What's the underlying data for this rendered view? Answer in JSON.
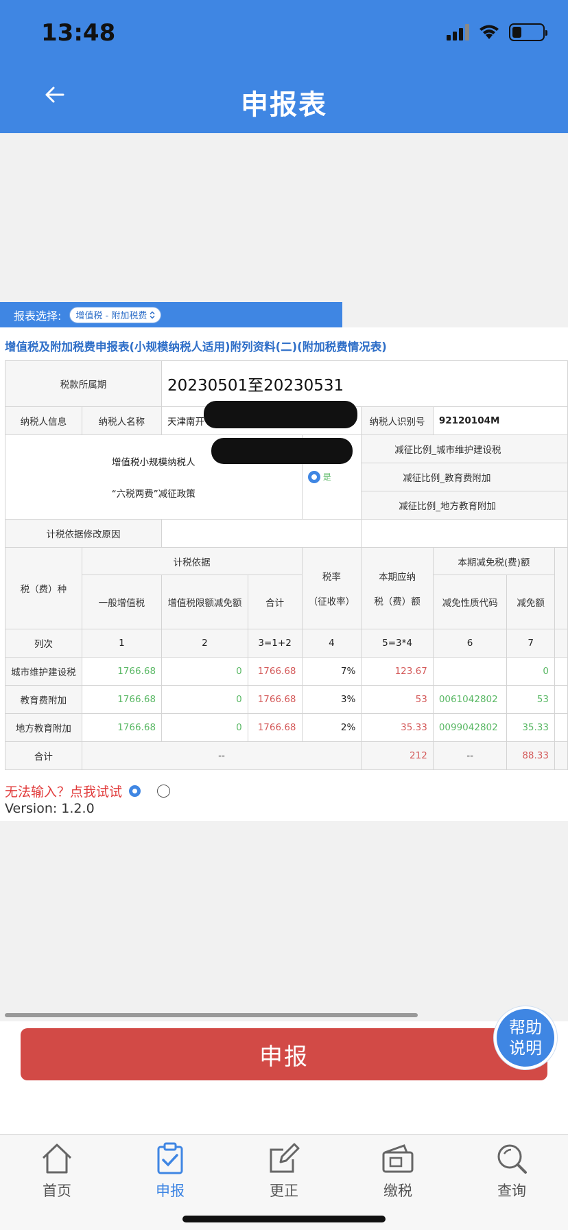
{
  "status_bar": {
    "time": "13:48"
  },
  "nav": {
    "title": "申报表"
  },
  "selector": {
    "label": "报表选择:",
    "value": "增值税 - 附加税费"
  },
  "form": {
    "title": "增值税及附加税费申报表(小规模纳税人适用)附列资料(二)(附加税费情况表)",
    "period_label": "税款所属期",
    "period_value": "20230501至20230531",
    "taxpayer_info_label": "纳税人信息",
    "taxpayer_name_label": "纳税人名称",
    "taxpayer_name_value": "天津南开",
    "taxpayer_id_label": "纳税人识别号",
    "taxpayer_id_value": "92120104M",
    "policy_line1": "增值税小规模纳税人",
    "policy_line2": "“六税两费”减征政策",
    "policy_yes": "是",
    "reduction_ratio_1": "减征比例_城市维护建设税",
    "reduction_ratio_2": "减征比例_教育费附加",
    "reduction_ratio_3": "减征比例_地方教育附加",
    "modify_reason_label": "计税依据修改原因",
    "headers": {
      "tax_type": "税（费）种",
      "basis": "计税依据",
      "general_vat": "一般增值税",
      "vat_limit_reduction": "增值税限额减免额",
      "total": "合计",
      "rate_line1": "税率",
      "rate_line2": "（征收率）",
      "payable_line1": "本期应纳",
      "payable_line2": "税（费）额",
      "reduction_section": "本期减免税(费)额",
      "reduction_code": "减免性质代码",
      "reduction_amount": "减免额"
    },
    "column_numbers": {
      "label": "列次",
      "c1": "1",
      "c2": "2",
      "c3": "3=1+2",
      "c4": "4",
      "c5": "5=3*4",
      "c6": "6",
      "c7": "7"
    },
    "rows": [
      {
        "name": "城市维护建设税",
        "general_vat": "1766.68",
        "limit_reduction": "0",
        "total": "1766.68",
        "rate": "7%",
        "payable": "123.67",
        "code": "",
        "reduction": "0"
      },
      {
        "name": "教育费附加",
        "general_vat": "1766.68",
        "limit_reduction": "0",
        "total": "1766.68",
        "rate": "3%",
        "payable": "53",
        "code": "0061042802",
        "reduction": "53"
      },
      {
        "name": "地方教育附加",
        "general_vat": "1766.68",
        "limit_reduction": "0",
        "total": "1766.68",
        "rate": "2%",
        "payable": "35.33",
        "code": "0099042802",
        "reduction": "35.33"
      }
    ],
    "total_row": {
      "label": "合计",
      "basis": "--",
      "payable": "212",
      "code": "--",
      "reduction": "88.33"
    }
  },
  "hint": {
    "text": "无法输入？点我试试"
  },
  "version": {
    "text": "Version: 1.2.0"
  },
  "submit": {
    "label": "申报"
  },
  "help": {
    "line1": "帮助",
    "line2": "说明"
  },
  "tabs": [
    {
      "label": "首页",
      "icon": "home-icon"
    },
    {
      "label": "申报",
      "icon": "clipboard-check-icon"
    },
    {
      "label": "更正",
      "icon": "edit-icon"
    },
    {
      "label": "缴税",
      "icon": "wallet-icon"
    },
    {
      "label": "查询",
      "icon": "search-icon"
    }
  ],
  "colors": {
    "primary": "#3f86e3",
    "danger": "#d24a46",
    "green": "#5ab865",
    "red": "#d45a5a"
  }
}
